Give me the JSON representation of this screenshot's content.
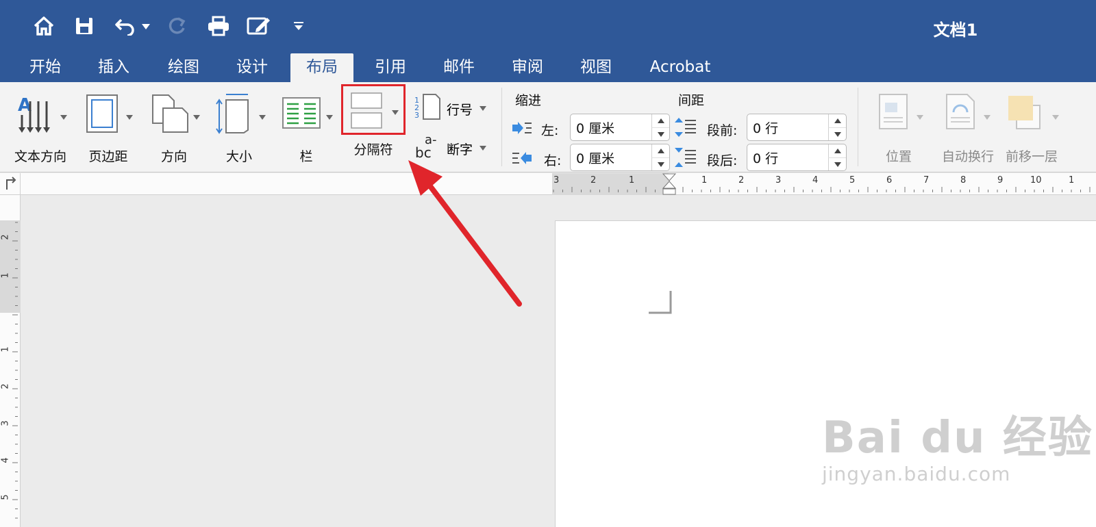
{
  "window": {
    "title": "文档1"
  },
  "quick_access": {
    "icons": [
      "home-icon",
      "save-icon",
      "undo-icon",
      "redo-icon",
      "print-icon",
      "edit-icon",
      "customize-icon"
    ]
  },
  "tabs": [
    {
      "label": "开始",
      "active": false
    },
    {
      "label": "插入",
      "active": false
    },
    {
      "label": "绘图",
      "active": false
    },
    {
      "label": "设计",
      "active": false
    },
    {
      "label": "布局",
      "active": true
    },
    {
      "label": "引用",
      "active": false
    },
    {
      "label": "邮件",
      "active": false
    },
    {
      "label": "审阅",
      "active": false
    },
    {
      "label": "视图",
      "active": false
    },
    {
      "label": "Acrobat",
      "active": false
    }
  ],
  "ribbon": {
    "text_direction": "文本方向",
    "margins": "页边距",
    "orientation": "方向",
    "size": "大小",
    "columns": "栏",
    "breaks": "分隔符",
    "line_numbers": "行号",
    "hyphenation": "断字",
    "indent": {
      "title": "缩进",
      "left_label": "左:",
      "left_value": "0 厘米",
      "right_label": "右:",
      "right_value": "0 厘米"
    },
    "spacing": {
      "title": "间距",
      "before_label": "段前:",
      "before_value": "0 行",
      "after_label": "段后:",
      "after_value": "0 行"
    },
    "position": "位置",
    "wrap_text": "自动换行",
    "bring_forward": "前移一层"
  },
  "ruler": {
    "left_numbers": [
      "3",
      "2",
      "1"
    ],
    "right_numbers": [
      "1",
      "2",
      "3",
      "4",
      "5",
      "6",
      "7",
      "8",
      "9",
      "10",
      "1"
    ],
    "vertical_numbers": [
      "2",
      "1",
      "1",
      "2",
      "3",
      "4",
      "5"
    ]
  },
  "watermark": {
    "main": "Bai du 经验",
    "sub": "jingyan.baidu.com"
  },
  "colors": {
    "accent": "#2f5898",
    "highlight": "#e0252b",
    "ribbon_bg": "#f3f3f3",
    "canvas": "#ebebeb"
  }
}
